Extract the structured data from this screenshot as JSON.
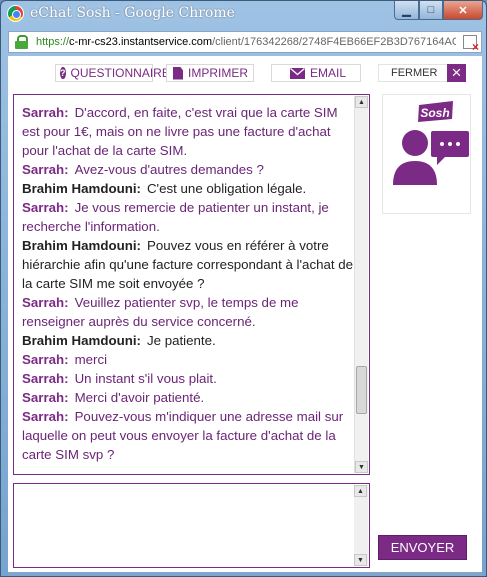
{
  "window": {
    "title": "eChat Sosh - Google Chrome"
  },
  "address": {
    "scheme": "https://",
    "host": "c-mr-cs23.instantservice.com",
    "path": "/client/176342268/2748F4EB66EF2B3D767164AC"
  },
  "toolbar": {
    "questionnaire": "QUESTIONNAIRE",
    "imprimer": "IMPRIMER",
    "email": "EMAIL",
    "fermer": "FERMER"
  },
  "brand": {
    "logo_text": "Sosh",
    "accent": "#7b2a85"
  },
  "messages": [
    {
      "speaker": "Sarrah:",
      "role": "agent",
      "text": "D'accord, en faite, c'est vrai que la carte SIM est pour 1€, mais on ne livre pas une facture d'achat pour l'achat de la carte SIM."
    },
    {
      "speaker": "Sarrah:",
      "role": "agent",
      "text": "Avez-vous d'autres demandes ?"
    },
    {
      "speaker": "Brahim Hamdouni:",
      "role": "user",
      "text": "C'est une obligation légale."
    },
    {
      "speaker": "Sarrah:",
      "role": "agent",
      "text": "Je vous remercie de patienter un instant, je recherche l'information."
    },
    {
      "speaker": "Brahim Hamdouni:",
      "role": "user",
      "text": "Pouvez vous en référer à votre hiérarchie afin qu'une facture correspondant à l'achat de la carte SIM me soit envoyée ?"
    },
    {
      "speaker": "Sarrah:",
      "role": "agent",
      "text": "Veuillez patienter svp, le temps de me renseigner auprès du service concerné."
    },
    {
      "speaker": "Brahim Hamdouni:",
      "role": "user",
      "text": "Je patiente."
    },
    {
      "speaker": "Sarrah:",
      "role": "agent",
      "text": "merci"
    },
    {
      "speaker": "Sarrah:",
      "role": "agent",
      "text": "Un instant s'il vous plait."
    },
    {
      "speaker": "Sarrah:",
      "role": "agent",
      "text": "Merci d'avoir patienté."
    },
    {
      "speaker": "Sarrah:",
      "role": "agent",
      "text": "Pouvez-vous m'indiquer une adresse mail sur laquelle on peut vous envoyer la facture d'achat de la carte SIM svp ?"
    }
  ],
  "composer": {
    "value": "",
    "send_label": "ENVOYER"
  }
}
